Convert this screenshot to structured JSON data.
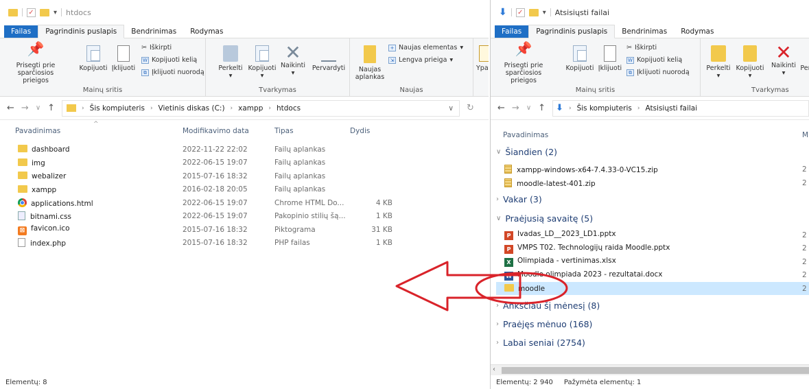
{
  "left": {
    "title": "htdocs",
    "tabs": [
      "Failas",
      "Pagrindinis puslapis",
      "Bendrinimas",
      "Rodymas"
    ],
    "ribbon": {
      "pin_label_1": "Prisegti prie",
      "pin_label_2": "sparčiosios prieigos",
      "copy": "Kopijuoti",
      "paste": "Įklijuoti",
      "cut": "Iškirpti",
      "copy_path": "Kopijuoti kelią",
      "paste_shortcut": "Įklijuoti nuorodą",
      "group_clipboard": "Mainų sritis",
      "move": "Perkelti",
      "copyto": "Kopijuoti",
      "delete": "Naikinti",
      "rename": "Pervardyti",
      "group_organize": "Tvarkymas",
      "new_folder_1": "Naujas",
      "new_folder_2": "aplankas",
      "new_item": "Naujas elementas",
      "easy_access": "Lengva prieiga",
      "group_new": "Naujas",
      "props": "Ypatyb"
    },
    "breadcrumb": [
      "Šis kompiuteris",
      "Vietinis diskas (C:)",
      "xampp",
      "htdocs"
    ],
    "columns": {
      "name": "Pavadinimas",
      "modified": "Modifikavimo data",
      "type": "Tipas",
      "size": "Dydis"
    },
    "files": [
      {
        "name": "dashboard",
        "date": "2022-11-22 22:02",
        "type": "Failų aplankas",
        "size": "",
        "icon": "folder"
      },
      {
        "name": "img",
        "date": "2022-06-15 19:07",
        "type": "Failų aplankas",
        "size": "",
        "icon": "folder"
      },
      {
        "name": "webalizer",
        "date": "2015-07-16 18:32",
        "type": "Failų aplankas",
        "size": "",
        "icon": "folder"
      },
      {
        "name": "xampp",
        "date": "2016-02-18 20:05",
        "type": "Failų aplankas",
        "size": "",
        "icon": "folder"
      },
      {
        "name": "applications.html",
        "date": "2022-06-15 19:07",
        "type": "Chrome HTML Do...",
        "size": "4 KB",
        "icon": "chrome"
      },
      {
        "name": "bitnami.css",
        "date": "2022-06-15 19:07",
        "type": "Pakopinio stilių šą...",
        "size": "1 KB",
        "icon": "css"
      },
      {
        "name": "favicon.ico",
        "date": "2015-07-16 18:32",
        "type": "Piktograma",
        "size": "31 KB",
        "icon": "xampp"
      },
      {
        "name": "index.php",
        "date": "2015-07-16 18:32",
        "type": "PHP failas",
        "size": "1 KB",
        "icon": "doc"
      }
    ],
    "status": "Elementų: 8"
  },
  "right": {
    "title": "Atsisiųsti failai",
    "tabs": [
      "Failas",
      "Pagrindinis puslapis",
      "Bendrinimas",
      "Rodymas"
    ],
    "ribbon": {
      "pin_label_1": "Prisegti prie",
      "pin_label_2": "sparčiosios prieigos",
      "copy": "Kopijuoti",
      "paste": "Įklijuoti",
      "cut": "Iškirpti",
      "copy_path": "Kopijuoti kelią",
      "paste_shortcut": "Įklijuoti nuorodą",
      "group_clipboard": "Mainų sritis",
      "move": "Perkelti",
      "copyto": "Kopijuoti",
      "delete": "Naikinti",
      "rename_cut": "Per",
      "group_organize": "Tvarkymas"
    },
    "breadcrumb": [
      "Šis kompiuteris",
      "Atsisiųsti failai"
    ],
    "columns": {
      "name": "Pavadinimas",
      "m": "M"
    },
    "groups": [
      {
        "label": "Šiandien (2)",
        "expanded": true
      },
      {
        "label": "Vakar (3)",
        "expanded": false
      },
      {
        "label": "Praėjusią savaitę (5)",
        "expanded": true
      },
      {
        "label": "Anksčiau šį mėnesį (8)",
        "expanded": false
      },
      {
        "label": "Praėjęs mėnuo (168)",
        "expanded": false
      },
      {
        "label": "Labai seniai (2754)",
        "expanded": false
      }
    ],
    "today_files": [
      {
        "name": "xampp-windows-x64-7.4.33-0-VC15.zip",
        "icon": "zip",
        "date_cut": "2"
      },
      {
        "name": "moodle-latest-401.zip",
        "icon": "zip",
        "date_cut": "2"
      }
    ],
    "week_files": [
      {
        "name": "Ivadas_LD__2023_LD1.pptx",
        "icon": "ppt",
        "date_cut": "2"
      },
      {
        "name": "VMPS T02. Technologijų raida Moodle.pptx",
        "icon": "ppt",
        "date_cut": "2"
      },
      {
        "name": "Olimpiada - vertinimas.xlsx",
        "icon": "xls",
        "date_cut": "2"
      },
      {
        "name": "Moodle olimpiada 2023 - rezultatai.docx",
        "icon": "docx",
        "date_cut": "2"
      },
      {
        "name": "moodle",
        "icon": "folder",
        "date_cut": "2",
        "selected": true
      }
    ],
    "status_count": "Elementų: 2 940",
    "status_selected": "Pažymėta elementų: 1"
  },
  "colors": {
    "accent": "#1f6fc5",
    "selection": "#cce8ff",
    "annotation": "#d9232a",
    "folder": "#f2c94c"
  }
}
